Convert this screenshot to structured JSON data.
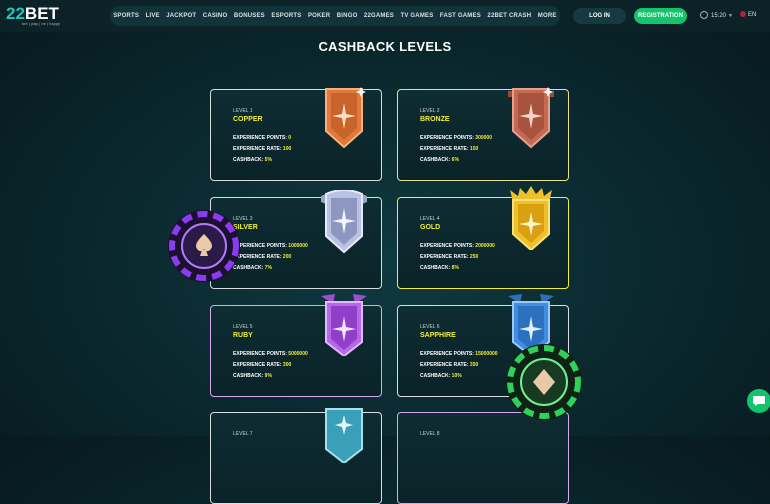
{
  "header": {
    "logo_text_prefix": "22",
    "logo_text": "BET",
    "logo_tagline": "bet | play | be | happy",
    "nav": [
      "SPORTS",
      "LIVE",
      "JACKPOT",
      "CASINO",
      "BONUSES",
      "ESPORTS",
      "POKER",
      "BINGO",
      "22GAMES",
      "TV GAMES",
      "FAST GAMES",
      "22BET CRASH",
      "MORE"
    ],
    "login_label": "LOG IN",
    "register_label": "REGISTRATION",
    "time": "15:20",
    "language": "EN",
    "colors": {
      "accent_green": "#14c46c",
      "teal": "#20c7c0"
    }
  },
  "page_title": "CASHBACK LEVELS",
  "labels": {
    "experience_points": "EXPERIENCE POINTS:",
    "experience_rate": "EXPERIENCE RATE:",
    "cashback": "CASHBACK:"
  },
  "levels": [
    {
      "level": "LEVEL 1",
      "name": "COPPER",
      "points": "0",
      "rate": "100",
      "cashback": "5%",
      "badge_color": "#e07a3c",
      "highlight": "#d9dde0"
    },
    {
      "level": "LEVEL 2",
      "name": "BRONZE",
      "points": "300000",
      "rate": "150",
      "cashback": "6%",
      "badge_color": "#c56a52",
      "highlight": "#e8e28a"
    },
    {
      "level": "LEVEL 3",
      "name": "SILVER",
      "points": "1000000",
      "rate": "200",
      "cashback": "7%",
      "badge_color": "#b9c2e4",
      "highlight": "#d9dde0"
    },
    {
      "level": "LEVEL 4",
      "name": "GOLD",
      "points": "2000000",
      "rate": "250",
      "cashback": "8%",
      "badge_color": "#f0c02a",
      "highlight": "#f2ee3a"
    },
    {
      "level": "LEVEL 5",
      "name": "RUBY",
      "points": "5000000",
      "rate": "300",
      "cashback": "9%",
      "badge_color": "#b768e6",
      "highlight": "#d9a8f0"
    },
    {
      "level": "LEVEL 6",
      "name": "SAPPHIRE",
      "points": "15000000",
      "rate": "350",
      "cashback": "10%",
      "badge_color": "#3f8ee0",
      "highlight": "#d9dde0"
    },
    {
      "level": "LEVEL 7"
    },
    {
      "level": "LEVEL 8"
    }
  ]
}
